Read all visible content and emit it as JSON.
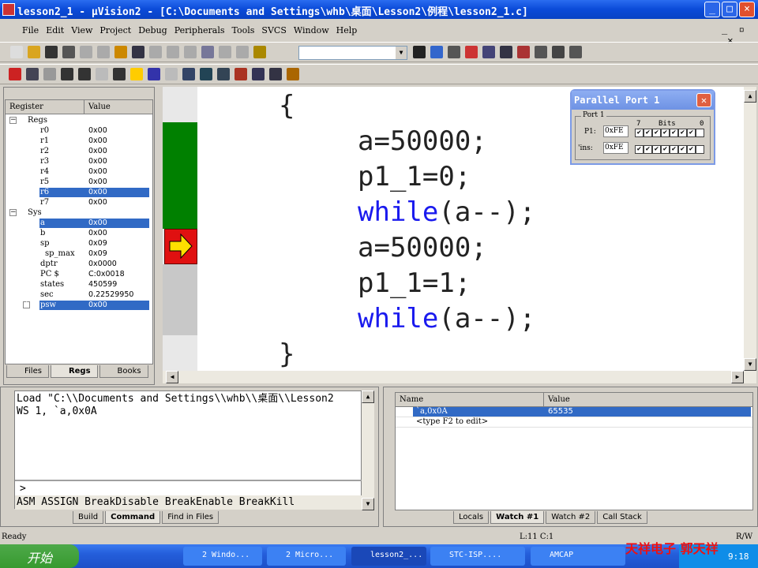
{
  "window": {
    "title": "lesson2_1  - µVision2 - [C:\\Documents and Settings\\whb\\桌面\\Lesson2\\例程\\lesson2_1.c]",
    "minimize": "_",
    "maximize": "□",
    "close": "×"
  },
  "menu": [
    "File",
    "Edit",
    "View",
    "Project",
    "Debug",
    "Peripherals",
    "Tools",
    "SVCS",
    "Window",
    "Help"
  ],
  "registers": {
    "headers": [
      "Register",
      "Value"
    ],
    "rows": [
      {
        "name": "Regs",
        "value": "",
        "level": 0,
        "expander": "−"
      },
      {
        "name": "r0",
        "value": "0x00",
        "level": 1
      },
      {
        "name": "r1",
        "value": "0x00",
        "level": 1
      },
      {
        "name": "r2",
        "value": "0x00",
        "level": 1
      },
      {
        "name": "r3",
        "value": "0x00",
        "level": 1
      },
      {
        "name": "r4",
        "value": "0x00",
        "level": 1
      },
      {
        "name": "r5",
        "value": "0x00",
        "level": 1
      },
      {
        "name": "r6",
        "value": "0x00",
        "level": 1,
        "selected": true
      },
      {
        "name": "r7",
        "value": "0x00",
        "level": 1
      },
      {
        "name": "Sys",
        "value": "",
        "level": 0,
        "expander": "−"
      },
      {
        "name": "a",
        "value": "0x00",
        "level": 1,
        "selected": true
      },
      {
        "name": "b",
        "value": "0x00",
        "level": 1
      },
      {
        "name": "sp",
        "value": "0x09",
        "level": 1
      },
      {
        "name": "sp_max",
        "value": "0x09",
        "level": 2
      },
      {
        "name": "dptr",
        "value": "0x0000",
        "level": 1
      },
      {
        "name": "PC  $",
        "value": "C:0x0018",
        "level": 1
      },
      {
        "name": "states",
        "value": "450599",
        "level": 1
      },
      {
        "name": "sec",
        "value": "0.22529950",
        "level": 1
      },
      {
        "name": "psw",
        "value": "0x00",
        "level": 1,
        "selected": true,
        "expander": "+"
      }
    ],
    "tabs": [
      "Files",
      "Regs",
      "Books"
    ],
    "active_tab": "Regs"
  },
  "editor": {
    "lines": [
      {
        "text": "{",
        "indent": 0
      },
      {
        "text": "a=50000;",
        "indent": 1
      },
      {
        "text": "p1_1=0;",
        "indent": 1
      },
      {
        "kw": "while",
        "text": "(a--);",
        "indent": 1
      },
      {
        "text": "a=50000;",
        "indent": 1
      },
      {
        "text": "p1_1=1;",
        "indent": 1
      },
      {
        "kw": "while",
        "text": "(a--);",
        "indent": 1
      },
      {
        "text": "}",
        "indent": 0
      }
    ]
  },
  "parallel_port": {
    "title": "Parallel Port 1",
    "group": "Port 1",
    "bits_label": "Bits",
    "bit_high": "7",
    "bit_low": "0",
    "p1_label": "P1:",
    "p1_value": "0xFE",
    "p1_bits": [
      1,
      1,
      1,
      1,
      1,
      1,
      1,
      0
    ],
    "pins_label": "'ins:",
    "pins_value": "0xFE",
    "pins_bits": [
      1,
      1,
      1,
      1,
      1,
      1,
      1,
      0
    ]
  },
  "command": {
    "lines": [
      "Load \"C:\\\\Documents and Settings\\\\whb\\\\桌面\\\\Lesson2",
      "WS 1, `a,0x0A"
    ],
    "prompt": ">",
    "hint": "ASM ASSIGN BreakDisable BreakEnable BreakKill",
    "tabs": [
      "Build",
      "Command",
      "Find in Files"
    ],
    "active_tab": "Command"
  },
  "watch": {
    "headers": [
      "Name",
      "Value"
    ],
    "rows": [
      {
        "name": "`a,0x0A",
        "value": "65535",
        "selected": true
      },
      {
        "name": "<type F2 to edit>",
        "value": ""
      }
    ],
    "tabs": [
      "Locals",
      "Watch #1",
      "Watch #2",
      "Call Stack"
    ],
    "active_tab": "Watch #1"
  },
  "status": {
    "text": "Ready",
    "position": "L:11 C:1",
    "mode": "R/W"
  },
  "taskbar": {
    "start": "开始",
    "tasks": [
      "2 Windo...",
      "2 Micro...",
      "lesson2_...",
      "STC-ISP....",
      "AMCAP"
    ],
    "time": "9:18",
    "watermark": "天祥电子  郭天祥"
  },
  "colors": {
    "selection": "#316ac5",
    "keyword": "#1a1aee",
    "exec_bar": "#008000",
    "arrow": "#ffe000"
  }
}
